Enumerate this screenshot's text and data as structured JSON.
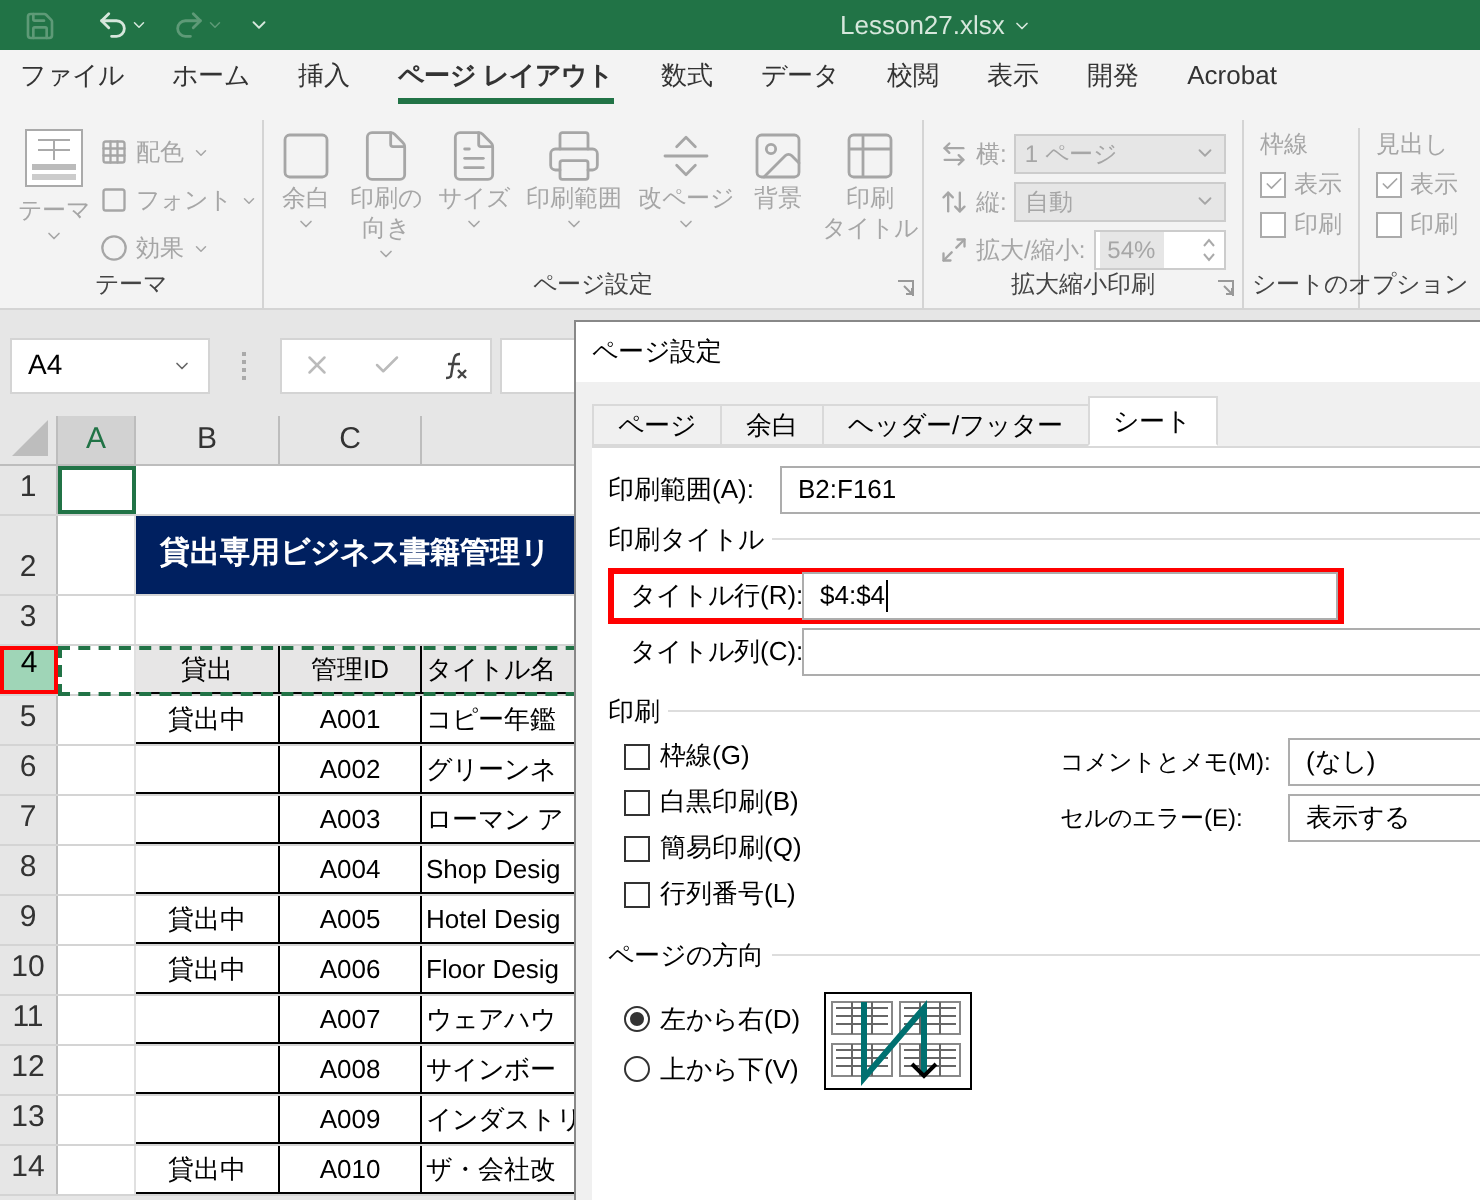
{
  "title_bar": {
    "filename": "Lesson27.xlsx"
  },
  "ribbon_tabs": [
    {
      "label": "ファイル",
      "selected": false
    },
    {
      "label": "ホーム",
      "selected": false
    },
    {
      "label": "挿入",
      "selected": false
    },
    {
      "label": "ページ レイアウト",
      "selected": true
    },
    {
      "label": "数式",
      "selected": false
    },
    {
      "label": "データ",
      "selected": false
    },
    {
      "label": "校閲",
      "selected": false
    },
    {
      "label": "表示",
      "selected": false
    },
    {
      "label": "開発",
      "selected": false
    },
    {
      "label": "Acrobat",
      "selected": false
    }
  ],
  "theme_group": {
    "label": "テーマ",
    "large_button": "テーマ",
    "small_buttons": [
      {
        "kind": "colors",
        "label": "配色"
      },
      {
        "kind": "fonts",
        "label": "フォント"
      },
      {
        "kind": "effects",
        "label": "効果"
      }
    ]
  },
  "page_setup_group": {
    "label": "ページ設定",
    "launcher": true,
    "buttons": [
      {
        "kind": "margins",
        "lines": [
          "余白"
        ],
        "dropdown": true
      },
      {
        "kind": "orientation",
        "lines": [
          "印刷の",
          "向き"
        ],
        "dropdown": true
      },
      {
        "kind": "size",
        "lines": [
          "サイズ"
        ],
        "dropdown": true
      },
      {
        "kind": "area",
        "lines": [
          "印刷範囲"
        ],
        "dropdown": true
      },
      {
        "kind": "breaks",
        "lines": [
          "改ページ"
        ],
        "dropdown": true
      },
      {
        "kind": "background",
        "lines": [
          "背景"
        ],
        "dropdown": false
      },
      {
        "kind": "titles",
        "lines": [
          "印刷",
          "タイトル"
        ],
        "dropdown": false
      }
    ]
  },
  "scale_group": {
    "label": "拡大縮小印刷",
    "launcher": true,
    "rows": [
      {
        "kind": "dropdown",
        "label": "横:",
        "value": "1 ページ"
      },
      {
        "kind": "dropdown",
        "label": "縦:",
        "value": "自動"
      },
      {
        "kind": "spinner",
        "label": "拡大/縮小:",
        "value": "54%"
      }
    ]
  },
  "sheet_options_group": {
    "label": "シートのオプション",
    "columns": [
      {
        "heading": "枠線",
        "options": [
          {
            "label": "表示",
            "checked": true
          },
          {
            "label": "印刷",
            "checked": false
          }
        ]
      },
      {
        "heading": "見出し",
        "options": [
          {
            "label": "表示",
            "checked": true
          },
          {
            "label": "印刷",
            "checked": false
          }
        ]
      }
    ]
  },
  "formula_bar": {
    "name_box": "A4"
  },
  "sheet": {
    "columns": [
      {
        "label": "A",
        "selected": true
      },
      {
        "label": "B",
        "selected": false
      },
      {
        "label": "C",
        "selected": false
      }
    ],
    "rows": [
      {
        "number": "1",
        "kind": "blank",
        "selected": false,
        "active_cell": true
      },
      {
        "number": "2",
        "kind": "banner",
        "selected": false,
        "active_cell": false,
        "title": "貸出専用ビジネス書籍管理リ"
      },
      {
        "number": "3",
        "kind": "blank",
        "selected": false,
        "active_cell": false
      },
      {
        "number": "4",
        "kind": "header",
        "selected": true,
        "active_cell": false,
        "marquee": true,
        "cells": [
          "貸出",
          "管理ID",
          "タイトル名"
        ]
      },
      {
        "number": "5",
        "kind": "data",
        "selected": false,
        "active_cell": false,
        "cells": [
          "貸出中",
          "A001",
          "コピー年鑑"
        ]
      },
      {
        "number": "6",
        "kind": "data",
        "selected": false,
        "active_cell": false,
        "cells": [
          "",
          "A002",
          "グリーンネ"
        ]
      },
      {
        "number": "7",
        "kind": "data",
        "selected": false,
        "active_cell": false,
        "cells": [
          "",
          "A003",
          "ローマン ア"
        ]
      },
      {
        "number": "8",
        "kind": "data",
        "selected": false,
        "active_cell": false,
        "cells": [
          "",
          "A004",
          "Shop Desig"
        ]
      },
      {
        "number": "9",
        "kind": "data",
        "selected": false,
        "active_cell": false,
        "cells": [
          "貸出中",
          "A005",
          "Hotel Desig"
        ]
      },
      {
        "number": "10",
        "kind": "data",
        "selected": false,
        "active_cell": false,
        "cells": [
          "貸出中",
          "A006",
          "Floor Desig"
        ]
      },
      {
        "number": "11",
        "kind": "data",
        "selected": false,
        "active_cell": false,
        "cells": [
          "",
          "A007",
          "ウェアハウ"
        ]
      },
      {
        "number": "12",
        "kind": "data",
        "selected": false,
        "active_cell": false,
        "cells": [
          "",
          "A008",
          "サインボー"
        ]
      },
      {
        "number": "13",
        "kind": "data",
        "selected": false,
        "active_cell": false,
        "cells": [
          "",
          "A009",
          "インダストリ"
        ]
      },
      {
        "number": "14",
        "kind": "data",
        "selected": false,
        "active_cell": false,
        "cells": [
          "貸出中",
          "A010",
          "ザ・会社改"
        ]
      }
    ]
  },
  "dialog": {
    "title": "ページ設定",
    "tabs": [
      {
        "label": "ページ",
        "selected": false
      },
      {
        "label": "余白",
        "selected": false
      },
      {
        "label": "ヘッダー/フッター",
        "selected": false
      },
      {
        "label": "シート",
        "selected": true
      }
    ],
    "print_area": {
      "label": "印刷範囲(A):",
      "value": "B2:F161"
    },
    "print_titles": {
      "heading": "印刷タイトル",
      "rows": {
        "label": "タイトル行(R):",
        "value": "$4:$4",
        "highlighted": true
      },
      "columns": {
        "label": "タイトル列(C):",
        "highlighted": false
      }
    },
    "print": {
      "heading": "印刷",
      "options": [
        {
          "label": "枠線(G)",
          "checked": false
        },
        {
          "label": "白黒印刷(B)",
          "checked": false
        },
        {
          "label": "簡易印刷(Q)",
          "checked": false
        },
        {
          "label": "行列番号(L)",
          "checked": false
        }
      ],
      "selects": [
        {
          "label": "コメントとメモ(M):",
          "value": "(なし)"
        },
        {
          "label": "セルのエラー(E):",
          "value": "表示する"
        }
      ]
    },
    "page_order": {
      "heading": "ページの方向",
      "options": [
        {
          "label": "左から右(D)",
          "selected": true
        },
        {
          "label": "上から下(V)",
          "selected": false
        }
      ]
    }
  }
}
